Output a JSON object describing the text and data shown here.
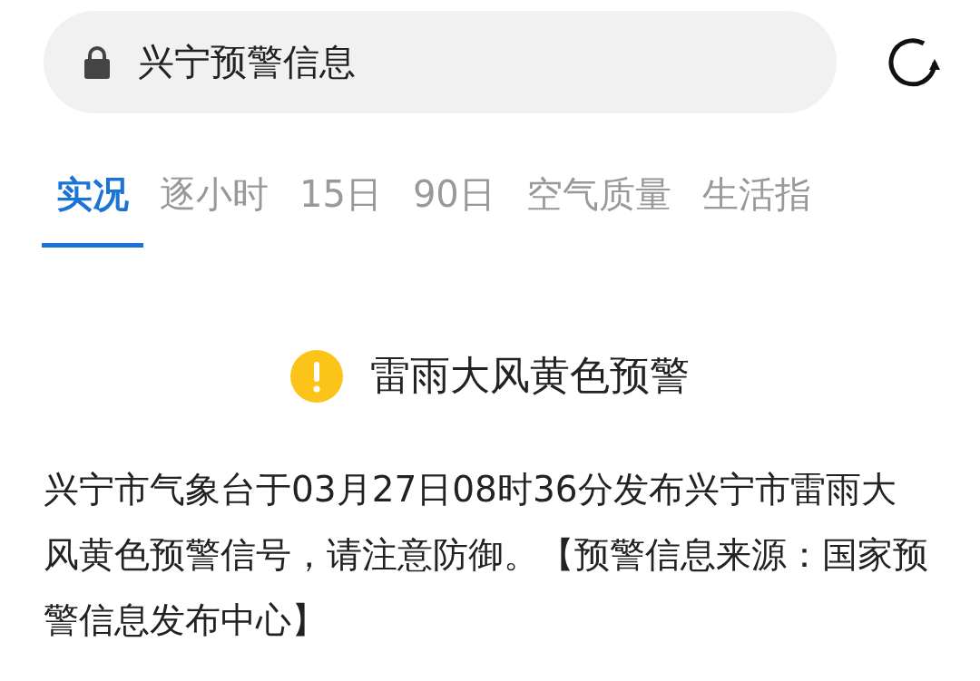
{
  "address_bar": {
    "title": "兴宁预警信息",
    "secure": true
  },
  "tabs": [
    {
      "label": "实况",
      "selected": true
    },
    {
      "label": "逐小时",
      "selected": false
    },
    {
      "label": "15日",
      "selected": false
    },
    {
      "label": "90日",
      "selected": false
    },
    {
      "label": "空气质量",
      "selected": false
    },
    {
      "label": "生活指",
      "selected": false
    }
  ],
  "alert": {
    "title": "雷雨大风黄色预警",
    "color": "#fcc419",
    "body": "兴宁市气象台于03月27日08时36分发布兴宁市雷雨大风黄色预警信号，请注意防御。【预警信息来源：国家预警信息发布中心】"
  }
}
